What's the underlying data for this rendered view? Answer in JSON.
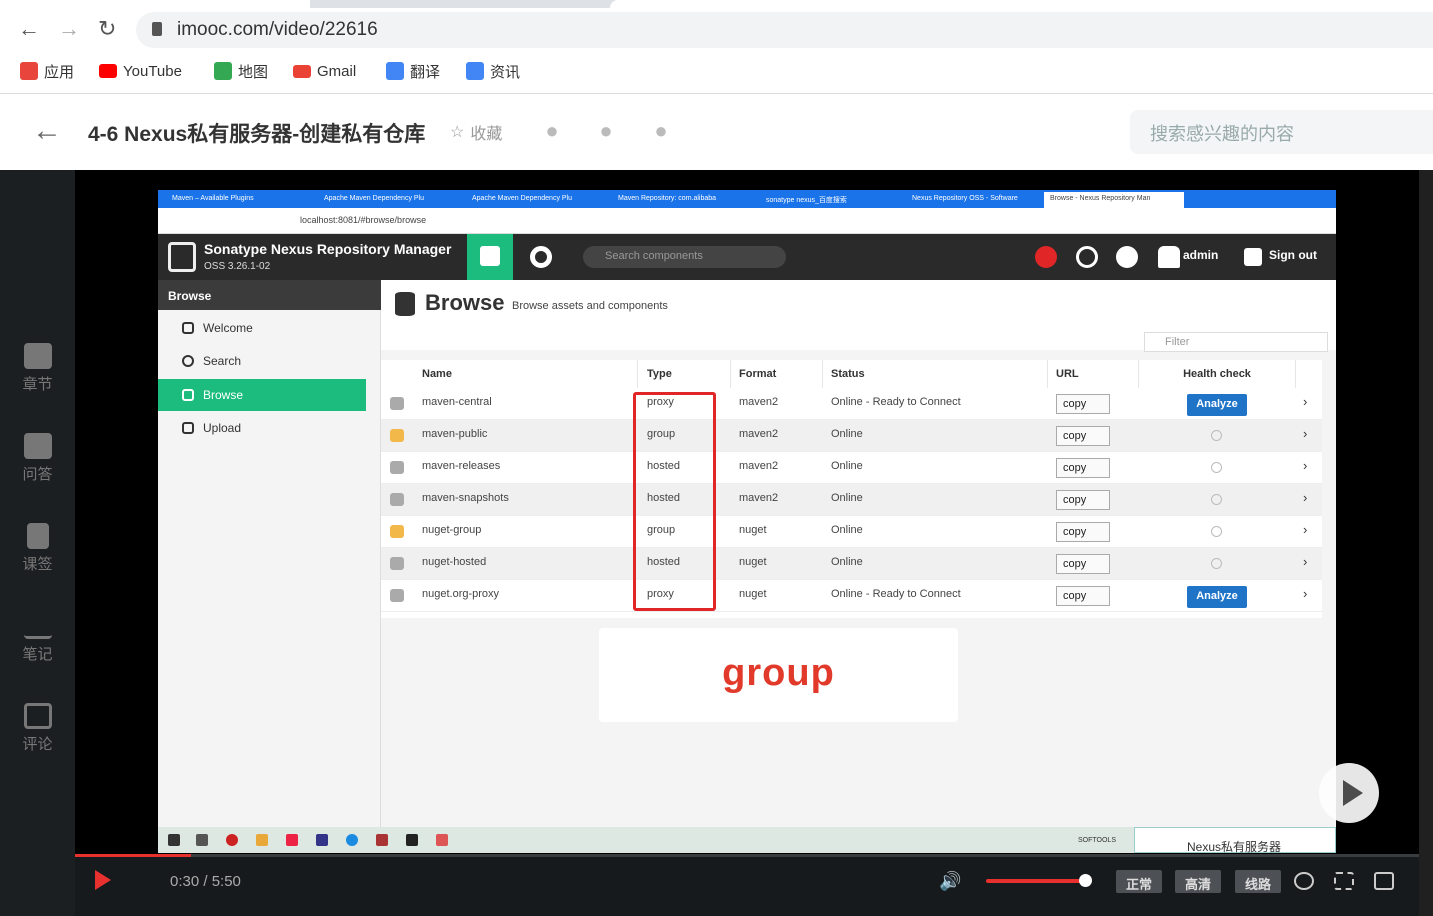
{
  "browser": {
    "url": "imooc.com/video/22616",
    "bookmarks": [
      {
        "label": "应用",
        "icon": "apps-grid-icon",
        "color": "#e8453c"
      },
      {
        "label": "YouTube",
        "icon": "youtube-icon",
        "color": "#ff0000"
      },
      {
        "label": "地图",
        "icon": "maps-icon",
        "color": "#34a853"
      },
      {
        "label": "Gmail",
        "icon": "gmail-icon",
        "color": "#ea4335"
      },
      {
        "label": "翻译",
        "icon": "translate-icon",
        "color": "#4285f4"
      },
      {
        "label": "资讯",
        "icon": "news-icon",
        "color": "#4285f4"
      }
    ]
  },
  "site": {
    "course_title": "4-6 Nexus私有服务器-创建私有仓库",
    "favorite_label": "收藏",
    "search_placeholder": "搜索感兴趣的内容",
    "rail": [
      {
        "label": "章节",
        "icon": "chapters-icon"
      },
      {
        "label": "问答",
        "icon": "qa-icon"
      },
      {
        "label": "课签",
        "icon": "bookmark-icon"
      },
      {
        "label": "笔记",
        "icon": "notes-icon"
      },
      {
        "label": "评论",
        "icon": "comments-icon"
      }
    ]
  },
  "video_screen": {
    "tabs": [
      "Maven – Available Plugins",
      "Apache Maven Dependency Plu",
      "Apache Maven Dependency Plu",
      "Maven Repository: com.alibaba",
      "sonatype nexus_百度搜索",
      "Nexus Repository OSS - Software",
      "Browse - Nexus Repository Man"
    ],
    "inner_url": "localhost:8081/#browse/browse",
    "nexus": {
      "app_title": "Sonatype Nexus Repository Manager",
      "version": "OSS 3.26.1-02",
      "search_placeholder": "Search components",
      "user": "admin",
      "sign_out": "Sign out",
      "sidebar_header": "Browse",
      "sidebar": [
        "Welcome",
        "Search",
        "Browse",
        "Upload"
      ],
      "page_title": "Browse",
      "page_subtitle": "Browse assets and components",
      "filter_placeholder": "Filter",
      "columns": [
        "Name",
        "Type",
        "Format",
        "Status",
        "URL",
        "Health check"
      ],
      "copy_label": "copy",
      "analyze_label": "Analyze",
      "rows": [
        {
          "name": "maven-central",
          "type": "proxy",
          "format": "maven2",
          "status": "Online - Ready to Connect",
          "health": "Analyze"
        },
        {
          "name": "maven-public",
          "type": "group",
          "format": "maven2",
          "status": "Online",
          "health": "na"
        },
        {
          "name": "maven-releases",
          "type": "hosted",
          "format": "maven2",
          "status": "Online",
          "health": "na"
        },
        {
          "name": "maven-snapshots",
          "type": "hosted",
          "format": "maven2",
          "status": "Online",
          "health": "na"
        },
        {
          "name": "nuget-group",
          "type": "group",
          "format": "nuget",
          "status": "Online",
          "health": "na"
        },
        {
          "name": "nuget-hosted",
          "type": "hosted",
          "format": "nuget",
          "status": "Online",
          "health": "na"
        },
        {
          "name": "nuget.org-proxy",
          "type": "proxy",
          "format": "nuget",
          "status": "Online - Ready to Connect",
          "health": "Analyze"
        }
      ]
    },
    "caption": "group",
    "taskbar_label": "SOFTOOLS",
    "watermark": "Nexus私有服务器"
  },
  "player": {
    "time": "0:30 / 5:50",
    "progress": 0.086,
    "volume": 0.93,
    "quality_buttons": [
      "正常",
      "高清",
      "线路"
    ],
    "accent": "#e8312f"
  }
}
